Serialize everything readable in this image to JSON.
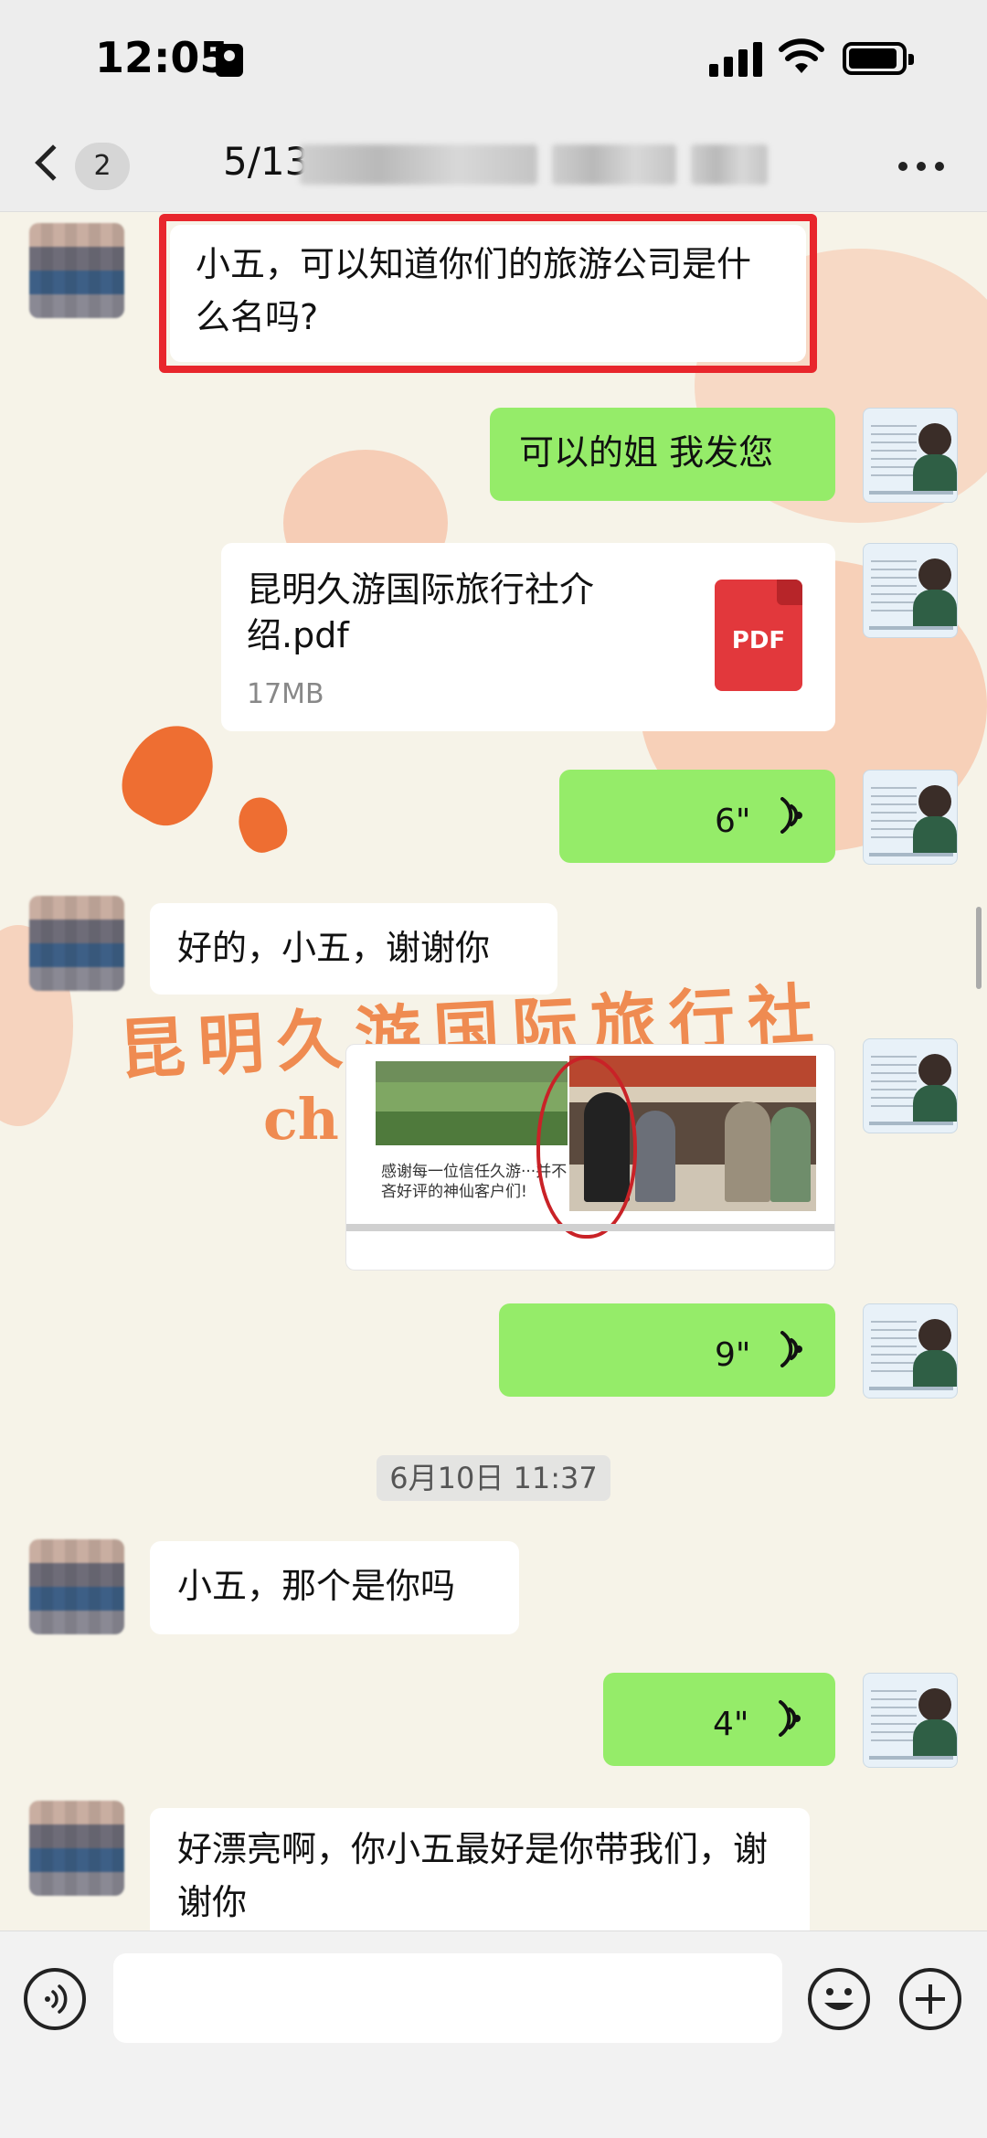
{
  "status_bar": {
    "time": "12:05"
  },
  "nav": {
    "back_count": "2",
    "title": "5/13"
  },
  "messages": {
    "m1_text": "小五，可以知道你们的旅游公司是什么名吗?",
    "m2_text": "可以的姐  我发您",
    "file": {
      "name": "昆明久游国际旅行社介绍.pdf",
      "size": "17MB",
      "type_label": "PDF"
    },
    "voice1_duration": "6\"",
    "m3_text": "好的，小五，谢谢你",
    "image_caption": "感谢每一位信任久游···并不吝好评的神仙客户们!",
    "voice2_duration": "9\"",
    "timestamp": "6月10日 11:37",
    "m4_text": "小五，那个是你吗",
    "voice3_duration": "4\"",
    "m5_text": "好漂亮啊，你小五最好是你带我们，谢谢你"
  },
  "background_decor": {
    "overlay_text": "昆明久游国际旅行社",
    "overlay_text_2": "ch"
  },
  "input_bar": {
    "placeholder": ""
  },
  "colors": {
    "bubble_green": "#95ec69",
    "highlight_red": "#e8262c",
    "pdf_red": "#e2383c",
    "decor_orange": "#ee7a37"
  }
}
